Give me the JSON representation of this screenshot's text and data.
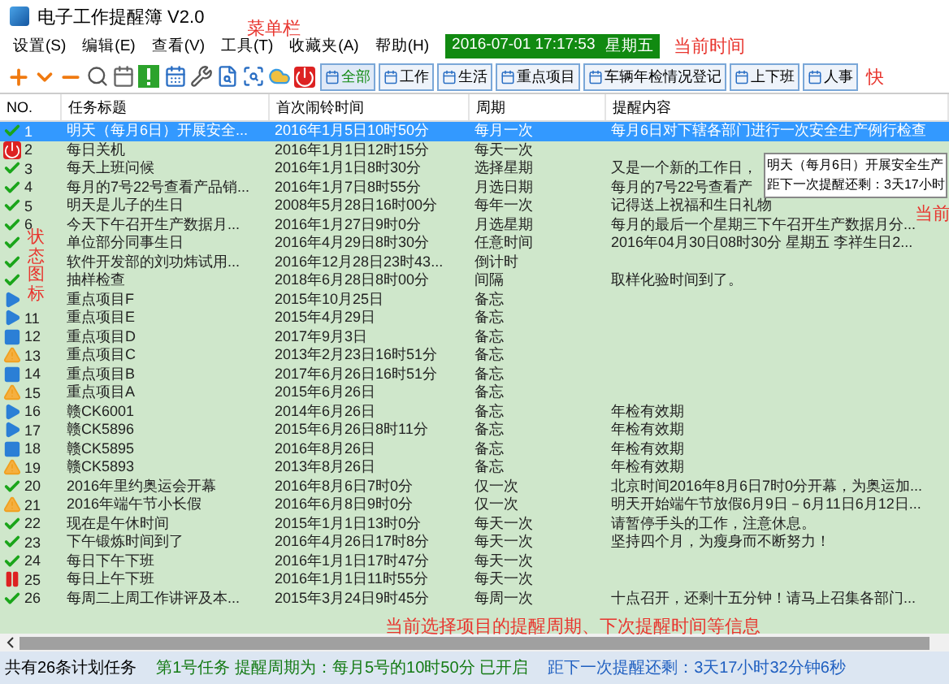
{
  "window": {
    "title": "电子工作提醒簿 V2.0"
  },
  "menu": [
    "设置(S)",
    "编辑(E)",
    "查看(V)",
    "工具(T)",
    "收藏夹(A)",
    "帮助(H)"
  ],
  "clock": {
    "date": "2016-07-01 17:17:53",
    "weekday": "星期五"
  },
  "quick_buttons": [
    {
      "label": "全部",
      "selected": true
    },
    {
      "label": "工作",
      "selected": false
    },
    {
      "label": "生活",
      "selected": false
    },
    {
      "label": "重点项目",
      "selected": false
    },
    {
      "label": "车辆年检情况登记",
      "selected": false
    },
    {
      "label": "上下班",
      "selected": false
    },
    {
      "label": "人事",
      "selected": false
    }
  ],
  "table": {
    "columns": [
      "NO.",
      "任务标题",
      "首次闹铃时间",
      "周期",
      "提醒内容"
    ],
    "rows": [
      {
        "no": "1",
        "kind": "check",
        "selected": true,
        "title": "明天（每月6日）开展安全...",
        "time": "2016年1月5日10时50分",
        "period": "每月一次",
        "content": "每月6日对下辖各部门进行一次安全生产例行检查"
      },
      {
        "no": "2",
        "kind": "power",
        "selected": false,
        "title": "每日关机",
        "time": "2016年1月1日12时15分",
        "period": "每天一次"
      },
      {
        "no": "3",
        "kind": "check",
        "selected": false,
        "title": "每天上班问候",
        "time": "2016年1月1日8时30分",
        "period": "选择星期",
        "content": "又是一个新的工作日，"
      },
      {
        "no": "4",
        "kind": "check",
        "selected": false,
        "title": "每月的7号22号查看产品销...",
        "time": "2016年1月7日8时55分",
        "period": "月选日期",
        "content": "每月的7号22号查看产"
      },
      {
        "no": "5",
        "kind": "check",
        "selected": false,
        "title": "明天是儿子的生日",
        "time": "2008年5月28日16时00分",
        "period": "每年一次",
        "content": "记得送上祝福和生日礼物"
      },
      {
        "no": "6",
        "kind": "check",
        "selected": false,
        "title": "今天下午召开生产数据月...",
        "time": "2016年1月27日9时0分",
        "period": "月选星期",
        "content": "每月的最后一个星期三下午召开生产数据月分..."
      },
      {
        "kind": "check",
        "selected": false,
        "title": "单位部分同事生日",
        "time": "2016年4月29日8时30分",
        "period": "任意时间",
        "content": "2016年04月30日08时30分 星期五 李祥生日2..."
      },
      {
        "kind": "check",
        "selected": false,
        "title": "软件开发部的刘功炜试用...",
        "time": "2016年12月28日23时43...",
        "period": "倒计时"
      },
      {
        "kind": "check",
        "selected": false,
        "title": "抽样检查",
        "time": "2018年6月28日8时00分",
        "period": "间隔",
        "content": "取样化验时间到了。"
      },
      {
        "kind": "play",
        "selected": false,
        "title": "重点项目F",
        "time": "2015年10月25日",
        "period": "备忘"
      },
      {
        "no": "11",
        "kind": "play",
        "selected": false,
        "title": "重点项目E",
        "time": "2015年4月29日",
        "period": "备忘"
      },
      {
        "no": "12",
        "kind": "square",
        "selected": false,
        "title": "重点项目D",
        "time": "2017年9月3日",
        "period": "备忘"
      },
      {
        "no": "13",
        "kind": "warning",
        "selected": false,
        "title": "重点项目C",
        "time": "2013年2月23日16时51分",
        "period": "备忘"
      },
      {
        "no": "14",
        "kind": "square",
        "selected": false,
        "title": "重点项目B",
        "time": "2017年6月26日16时51分",
        "period": "备忘"
      },
      {
        "no": "15",
        "kind": "warning",
        "selected": false,
        "title": "重点项目A",
        "time": "2015年6月26日",
        "period": "备忘"
      },
      {
        "no": "16",
        "kind": "play",
        "selected": false,
        "title": "赣CK6001",
        "time": "2014年6月26日",
        "period": "备忘",
        "content": "年检有效期"
      },
      {
        "no": "17",
        "kind": "play",
        "selected": false,
        "title": "赣CK5896",
        "time": "2015年6月26日8时11分",
        "period": "备忘",
        "content": "年检有效期"
      },
      {
        "no": "18",
        "kind": "square",
        "selected": false,
        "title": "赣CK5895",
        "time": "2016年8月26日",
        "period": "备忘",
        "content": "年检有效期"
      },
      {
        "no": "19",
        "kind": "warning",
        "selected": false,
        "title": "赣CK5893",
        "time": "2013年8月26日",
        "period": "备忘",
        "content": "年检有效期"
      },
      {
        "no": "20",
        "kind": "check",
        "selected": false,
        "title": "2016年里约奥运会开幕",
        "time": "2016年8月6日7时0分",
        "period": "仅一次",
        "content": "北京时间2016年8月6日7时0分开幕，为奥运加..."
      },
      {
        "no": "21",
        "kind": "warning",
        "selected": false,
        "title": "2016年端午节小长假",
        "time": "2016年6月8日9时0分",
        "period": "仅一次",
        "content": "明天开始端午节放假6月9日－6月11日6月12日..."
      },
      {
        "no": "22",
        "kind": "check",
        "selected": false,
        "title": "现在是午休时间",
        "time": "2015年1月1日13时0分",
        "period": "每天一次",
        "content": "请暂停手头的工作，注意休息。"
      },
      {
        "no": "23",
        "kind": "check",
        "selected": false,
        "title": "下午锻炼时间到了",
        "time": "2016年4月26日17时8分",
        "period": "每天一次",
        "content": "坚持四个月，为瘦身而不断努力！"
      },
      {
        "no": "24",
        "kind": "check",
        "selected": false,
        "title": "每日下午下班",
        "time": "2016年1月1日17时47分",
        "period": "每天一次"
      },
      {
        "no": "25",
        "kind": "pause",
        "selected": false,
        "title": "每日上午下班",
        "time": "2016年1月1日11时55分",
        "period": "每天一次"
      },
      {
        "no": "26",
        "kind": "check",
        "selected": false,
        "title": "每周二上周工作讲评及本...",
        "time": "2015年3月24日9时45分",
        "period": "每周一次",
        "content": "十点召开，还剩十五分钟！请马上召集各部门..."
      }
    ]
  },
  "tooltip": [
    "明天（每月6日）开展安全生产",
    "距下一次提醒还剩：3天17小时"
  ],
  "annotations": {
    "menu": "菜单栏",
    "clock": "当前时间",
    "toolbar": "快",
    "status_icons": "状态图标",
    "tooltip": "当前",
    "status": "当前选择项目的提醒周期、下次提醒时间等信息"
  },
  "status_bar": {
    "count": "共有26条计划任务",
    "task": "第1号任务 提醒周期为：每月5号的10时50分 已开启",
    "remaining": "距下一次提醒还剩：3天17小时32分钟6秒"
  }
}
